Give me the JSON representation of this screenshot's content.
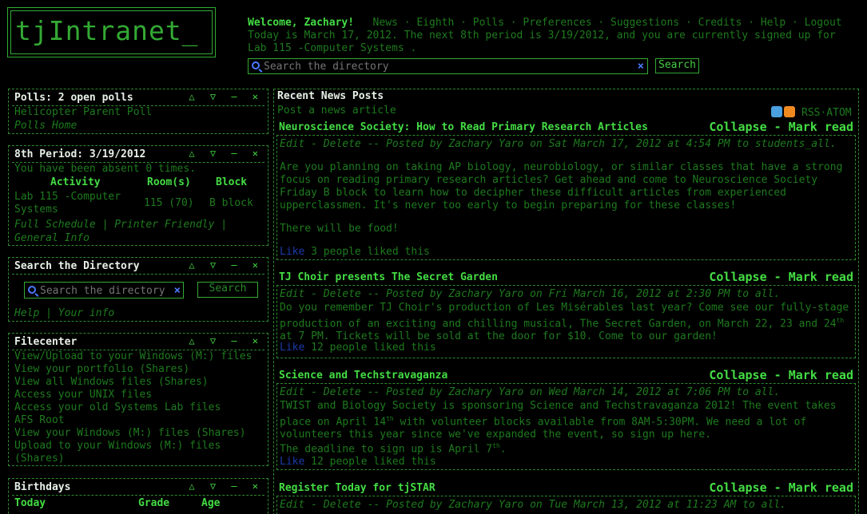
{
  "logo": "tjIntranet_",
  "header": {
    "welcome": "Welcome, Zachary!",
    "nav": [
      "News",
      "Eighth",
      "Polls",
      "Preferences",
      "Suggestions",
      "Credits",
      "Help",
      "Logout"
    ],
    "today": "Today is March 17, 2012. The next 8th period is 3/19/2012, and you are currently signed up for Lab 115 -Computer Systems .",
    "search_placeholder": "Search the directory",
    "search_button": "Search"
  },
  "polls": {
    "title": "Polls: 2 open polls",
    "items": [
      "Helicopter Parent Poll",
      "Polls Home"
    ]
  },
  "eighth": {
    "title": "8th Period: 3/19/2012",
    "absent": "You have been absent 0 times.",
    "headers": [
      "Activity",
      "Room(s)",
      "Block"
    ],
    "row": {
      "activity": "Lab 115 -Computer Systems",
      "room": "115 (70)",
      "block": "B block"
    },
    "links": [
      "Full Schedule",
      "Printer Friendly",
      "General Info"
    ]
  },
  "directory": {
    "title": "Search the Directory",
    "placeholder": "Search the directory",
    "button": "Search",
    "links": [
      "Help",
      "Your info"
    ]
  },
  "filecenter": {
    "title": "Filecenter",
    "items": [
      "View/Upload to your Windows (M:) files",
      "View your portfolio (Shares)",
      "View all Windows files (Shares)",
      "Access your UNIX files",
      "Access your old Systems Lab files",
      "AFS Root",
      "View your Windows (M:) files (Shares)",
      "Upload to your Windows (M:) files (Shares)"
    ]
  },
  "birthdays": {
    "title": "Birthdays",
    "headers": [
      "Today",
      "Grade",
      "Age"
    ]
  },
  "box_controls": "△ ▽ – ✕",
  "news": {
    "title": "Recent News Posts",
    "post_link": "Post a news article",
    "feeds": "RSS·ATOM",
    "collapse": "Collapse",
    "mark_read": "Mark read",
    "edit": "Edit",
    "delete": "Delete",
    "like": "Like",
    "posts": [
      {
        "title": "Neuroscience Society: How to Read Primary Research Articles",
        "meta": "-- Posted by Zachary Yaro on Sat March 17, 2012 at 4:54 PM to students_all.",
        "paras": [
          "Are you planning on taking AP biology, neurobiology, or similar classes that have a strong focus on reading primary research articles? Get ahead and come to Neuroscience Society Friday B block to learn how to decipher these difficult articles from experienced upperclassmen. It's never too early to begin preparing for these classes!",
          "There will be food!"
        ],
        "likes": "3 people liked this"
      },
      {
        "title": "TJ Choir presents The Secret Garden",
        "meta": "-- Posted by Zachary Yaro on Fri March 16, 2012 at 2:30 PM to all.",
        "body_a": "Do you remember TJ Choir's production of Les Misérables last year? Come see our fully-stage production of an exciting and chilling musical, The Secret Garden, on March 22, 23 and 24",
        "sup": "th",
        "body_b": " at 7 PM. Tickets will be sold at the door for $10. Come to our garden!",
        "likes": "12 people liked this"
      },
      {
        "title": "Science and Techstravaganza",
        "meta": "-- Posted by Zachary Yaro on Wed March 14, 2012 at 7:06 PM to all.",
        "body_a": "TWIST and Biology Society is sponsoring Science and Techstravaganza 2012! The event takes place on April 14",
        "sup": "th",
        "body_b": " with volunteer blocks available from 8AM-5:30PM. We need a lot of volunteers this year since we've expanded the event, so sign up here.",
        "body_c": "The deadline to sign up is April 7",
        "sup2": "th",
        "body_d": ".",
        "likes": "12 people liked this"
      },
      {
        "title": "Register Today for tjSTAR",
        "meta": "-- Posted by Zachary Yaro on Tue March 13, 2012 at 11:23 AM to all."
      }
    ]
  },
  "colors": {
    "accent": "#44dd44",
    "dim": "#1e7a1e",
    "link_blue": "#4a7aff",
    "bg": "#000000"
  }
}
